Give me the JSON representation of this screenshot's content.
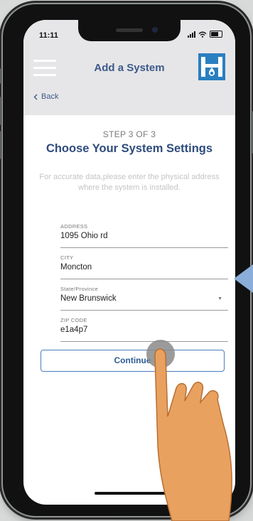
{
  "status_bar": {
    "time": "11:11"
  },
  "header": {
    "title": "Add a System",
    "back_label": "Back"
  },
  "page": {
    "step": "STEP 3 OF 3",
    "heading": "Choose Your System Settings",
    "description": "For accurate data,please enter the physical address where the system is installed."
  },
  "form": {
    "address": {
      "label": "ADDRESS",
      "value": "1095 Ohio rd"
    },
    "city": {
      "label": "CITY",
      "value": "Moncton"
    },
    "state": {
      "label": "State/Province",
      "value": "New Brunswick"
    },
    "zip": {
      "label": "ZIP CODE",
      "value": "e1a4p7"
    }
  },
  "actions": {
    "continue_label": "Continue"
  },
  "icons": [
    "hamburger-menu-icon",
    "logo-icon",
    "back-chevron-icon",
    "dropdown-caret-icon",
    "pointer-arrow-icon",
    "hand-pointer-icon"
  ],
  "colors": {
    "accent": "#3d5a8a",
    "header_bg": "#e6e6e8",
    "logo_bg": "#2a7fc0",
    "button_border": "#4a7ec0"
  }
}
